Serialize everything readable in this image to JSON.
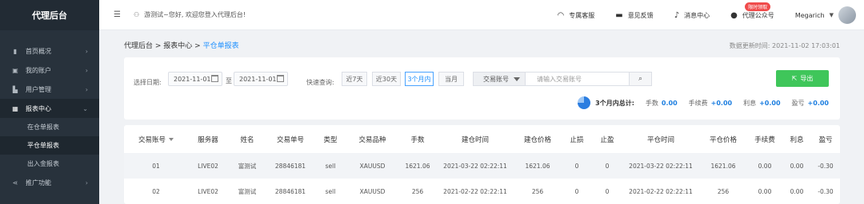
{
  "sidebar": {
    "brand": "代理后台",
    "items": [
      {
        "label": "首页概况",
        "icon": "bar-chart-icon",
        "glyph": "▮"
      },
      {
        "label": "我的账户",
        "icon": "account-icon",
        "glyph": "▣"
      },
      {
        "label": "用户管理",
        "icon": "users-icon",
        "glyph": "▙"
      },
      {
        "label": "报表中心",
        "icon": "grid-icon",
        "glyph": "▦"
      },
      {
        "label": "推广功能",
        "icon": "share-icon",
        "glyph": "⋖"
      }
    ],
    "sub_items": [
      "在仓单报表",
      "平仓单报表",
      "出入金报表"
    ]
  },
  "header": {
    "welcome": "游测试~您好, 欢迎您登入代理后台!",
    "service": "专属客服",
    "feedback": "意见反馈",
    "messages": "消息中心",
    "wechat": "代理公众号",
    "hot_badge": "限时领取",
    "username": "Megarich"
  },
  "breadcrumb": {
    "root": "代理后台",
    "section": "报表中心",
    "current": "平仓单报表",
    "sep": " > "
  },
  "updated": "数据更新时间: 2021-11-02 17:03:01",
  "filters": {
    "date_label": "选择日期:",
    "start_date": "2021-11-01",
    "to": "至",
    "end_date": "2021-11-01",
    "quick_label": "快速查询:",
    "quick": [
      "近7天",
      "近30天",
      "3个月内",
      "当月"
    ],
    "selected_quick": "3个月内",
    "account_type": "交易账号",
    "account_placeholder": "请输入交易账号",
    "export": "导出"
  },
  "summary": {
    "title": "3个月内总计:",
    "items": [
      {
        "label": "手数",
        "value": "0.00"
      },
      {
        "label": "手续费",
        "value": "+0.00"
      },
      {
        "label": "利息",
        "value": "+0.00"
      },
      {
        "label": "盈亏",
        "value": "+0.00"
      }
    ]
  },
  "table": {
    "headers": [
      "交易账号",
      "服务器",
      "姓名",
      "交易单号",
      "类型",
      "交易品种",
      "手数",
      "建仓时间",
      "建仓价格",
      "止损",
      "止盈",
      "平仓时间",
      "平仓价格",
      "手续费",
      "利息",
      "盈亏"
    ],
    "rows": [
      [
        "01",
        "LIVE02",
        "富测试",
        "28846181",
        "sell",
        "XAUUSD",
        "1621.06",
        "2021-03-22  02:22:11",
        "1621.06",
        "0",
        "0",
        "2021-03-22  02:22:11",
        "1621.06",
        "0.00",
        "0.00",
        "-0.30"
      ],
      [
        "02",
        "LIVE02",
        "富测试",
        "28846181",
        "sell",
        "XAUUSD",
        "256",
        "2021-02-22  02:22:11",
        "256",
        "0",
        "0",
        "2021-02-22  02:22:11",
        "256",
        "0.00",
        "0.00",
        "-0.30"
      ]
    ]
  }
}
